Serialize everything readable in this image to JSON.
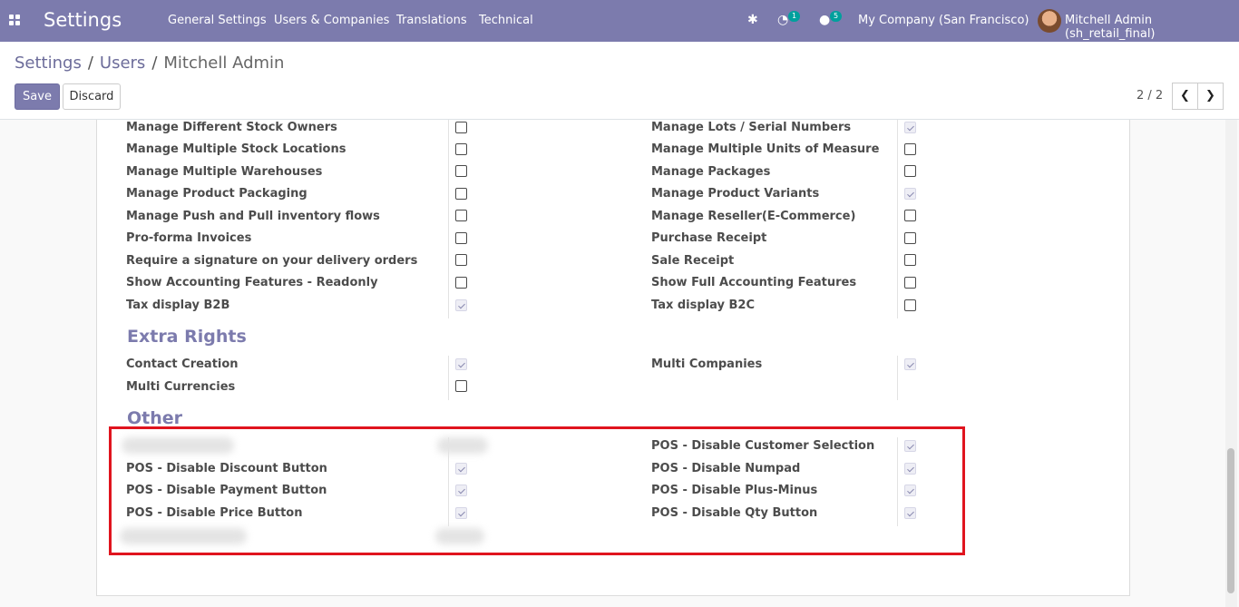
{
  "navbar": {
    "brand": "Settings",
    "menu": [
      "General Settings",
      "Users & Companies",
      "Translations",
      "Technical"
    ],
    "activity_count": "1",
    "messages_count": "5",
    "company": "My Company (San Francisco)",
    "user": "Mitchell Admin (sh_retail_final)",
    "icons": [
      "apps-grid-icon",
      "bug-icon",
      "clock-icon",
      "chat-icon"
    ]
  },
  "breadcrumb": [
    "Settings",
    "Users",
    "Mitchell Admin"
  ],
  "actions": {
    "save": "Save",
    "discard": "Discard"
  },
  "pager": {
    "value": "2 / 2"
  },
  "technical": {
    "left": [
      {
        "label": "Manage Different Stock Owners",
        "checked": false
      },
      {
        "label": "Manage Multiple Stock Locations",
        "checked": false
      },
      {
        "label": "Manage Multiple Warehouses",
        "checked": false
      },
      {
        "label": "Manage Product Packaging",
        "checked": false
      },
      {
        "label": "Manage Push and Pull inventory flows",
        "checked": false
      },
      {
        "label": "Pro-forma Invoices",
        "checked": false
      },
      {
        "label": "Require a signature on your delivery orders",
        "checked": false
      },
      {
        "label": "Show Accounting Features - Readonly",
        "checked": false
      },
      {
        "label": "Tax display B2B",
        "checked": true
      }
    ],
    "right": [
      {
        "label": "Manage Lots / Serial Numbers",
        "checked": true
      },
      {
        "label": "Manage Multiple Units of Measure",
        "checked": false
      },
      {
        "label": "Manage Packages",
        "checked": false
      },
      {
        "label": "Manage Product Variants",
        "checked": true
      },
      {
        "label": "Manage Reseller(E-Commerce)",
        "checked": false
      },
      {
        "label": "Purchase Receipt",
        "checked": false
      },
      {
        "label": "Sale Receipt",
        "checked": false
      },
      {
        "label": "Show Full Accounting Features",
        "checked": false
      },
      {
        "label": "Tax display B2C",
        "checked": false
      }
    ]
  },
  "extra_rights": {
    "title": "Extra Rights",
    "left": [
      {
        "label": "Contact Creation",
        "checked": true
      },
      {
        "label": "Multi Currencies",
        "checked": false
      }
    ],
    "right": [
      {
        "label": "Multi Companies",
        "checked": true
      }
    ]
  },
  "other": {
    "title": "Other",
    "left": [
      {
        "label": "POS - Disable Discount Button",
        "checked": true
      },
      {
        "label": "POS - Disable Payment Button",
        "checked": true
      },
      {
        "label": "POS - Disable Price Button",
        "checked": true
      }
    ],
    "right": [
      {
        "label": "POS - Disable Customer Selection",
        "checked": true
      },
      {
        "label": "POS - Disable Numpad",
        "checked": true
      },
      {
        "label": "POS - Disable Plus-Minus",
        "checked": true
      },
      {
        "label": "POS - Disable Qty Button",
        "checked": true
      }
    ]
  },
  "colors": {
    "primary": "#7c7bad",
    "highlight": "#e0141e",
    "badge": "#00a09d"
  }
}
